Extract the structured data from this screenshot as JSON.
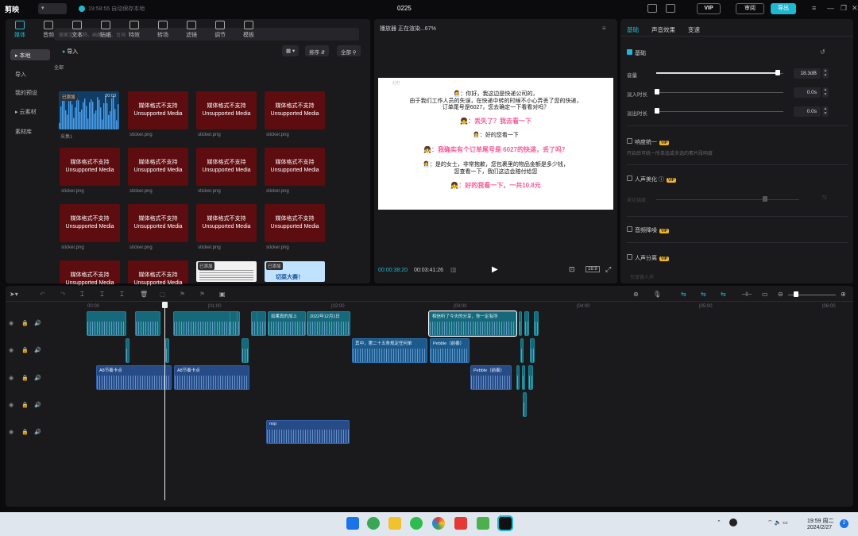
{
  "app": {
    "name": "剪映",
    "project_pill": "▾",
    "save_time": "19:58:55",
    "save_text": "自动保存本地",
    "title": "0225",
    "vip": "VIP",
    "review": "审阅",
    "export": "导出"
  },
  "media_tabs": [
    "媒体",
    "音频",
    "文本",
    "贴纸",
    "特效",
    "转场",
    "滤镜",
    "调节",
    "模板"
  ],
  "media_sidebar": [
    "本地",
    "导入",
    "我的预设",
    "云素材",
    "素材库"
  ],
  "search_placeholder": "搜索文件名称、画面元素、台词",
  "import_label": "导入",
  "controls": {
    "sort": "排序",
    "all": "全部"
  },
  "group_label": "全部",
  "audio_tile": {
    "badge": "已添加",
    "duration": "00:03",
    "name": "采集1"
  },
  "unsupported": {
    "line1": "媒体格式不支持",
    "line2": "Unsupported Media",
    "file": "sticker.png"
  },
  "img_tiles": [
    {
      "badge": "已添加"
    },
    {
      "badge": "已添加",
      "caption": "切菜大赛！"
    }
  ],
  "player": {
    "header": "播放器 正在渲染...67%",
    "current": "00:00:38:20",
    "total": "00:03:41:26",
    "ratio": "16:9",
    "subtitle": "幻灯",
    "lines": [
      {
        "text": "👩‍💼：你好，我这边是快递公司的，",
        "pink": false
      },
      {
        "text": "由于我们工作人员的失误，在快递中转的时候不小心弄丢了您的快递，",
        "pink": false
      },
      {
        "text": "订单尾号是6027，您去确定一下看看对吗？",
        "pink": false
      },
      {
        "text": "👧：丢失了？我去看一下",
        "pink": true
      },
      {
        "text": "👩‍💼：好的您看一下",
        "pink": false
      },
      {
        "text": "👧：我确实有个订单尾号是 6027的快递，丢了吗？",
        "pink": true
      },
      {
        "text": "👩‍💼：是的女士，非常抱歉，您包裹里的物品金额是多少钱，",
        "pink": false
      },
      {
        "text": "您查看一下，我们这边会赔付给您",
        "pink": false
      },
      {
        "text": "👧：好的我看一下，一共10.8元",
        "pink": true
      }
    ]
  },
  "props": {
    "tabs": [
      "基础",
      "声音效果",
      "变速"
    ],
    "basic": "基础",
    "volume_label": "音量",
    "volume_value": "18.3dB",
    "volume_level": 0.97,
    "fade_in_label": "淡入时长",
    "fade_in_value": "0.0s",
    "fade_out_label": "淡出时长",
    "fade_out_value": "0.0s",
    "loudness": "响度统一",
    "loudness_desc": "开启后可统一所单选或多选的素片段响度",
    "voice_beauty": "人声美化",
    "voice_beauty_sub": "美化强度",
    "voice_beauty_value": "75",
    "denoise": "音频降噪",
    "vocal_sep": "人声分离",
    "vocal_sep_sub": "仅保留人声",
    "vip": "VIP"
  },
  "timeline": {
    "ruler": [
      "00:00",
      "|01:00",
      "|02:00",
      "|03:00",
      "|04:00",
      "|05:00",
      "|06:00"
    ],
    "clips": [
      {
        "track": 0,
        "type": "video",
        "label": ""
      },
      {
        "track": 0,
        "type": "video",
        "label": ""
      },
      {
        "track": 0,
        "type": "video",
        "label": ""
      },
      {
        "track": 0,
        "type": "video",
        "label": ""
      },
      {
        "track": 0,
        "type": "video",
        "label": ""
      },
      {
        "track": 0,
        "type": "video",
        "label": "如果真的加上"
      },
      {
        "track": 0,
        "type": "video",
        "label": "2022年12月1日"
      },
      {
        "track": 0,
        "type": "video",
        "label": "相信听了今天的分享，你一定有所"
      },
      {
        "track": 1,
        "type": "text",
        "label": "其中，第二十五条规定任何单"
      },
      {
        "track": 1,
        "type": "text",
        "label": "Pebble（前奏）"
      },
      {
        "track": 2,
        "type": "audio",
        "label": "A8节奏卡点"
      },
      {
        "track": 2,
        "type": "audio",
        "label": "A8节奏卡点"
      },
      {
        "track": 2,
        "type": "audio",
        "label": "Pebble（前奏）"
      },
      {
        "track": 4,
        "type": "audio",
        "label": "nop"
      }
    ]
  },
  "taskbar": {
    "time": "19:59 周二",
    "date": "2024/2/27",
    "notif": "2"
  }
}
